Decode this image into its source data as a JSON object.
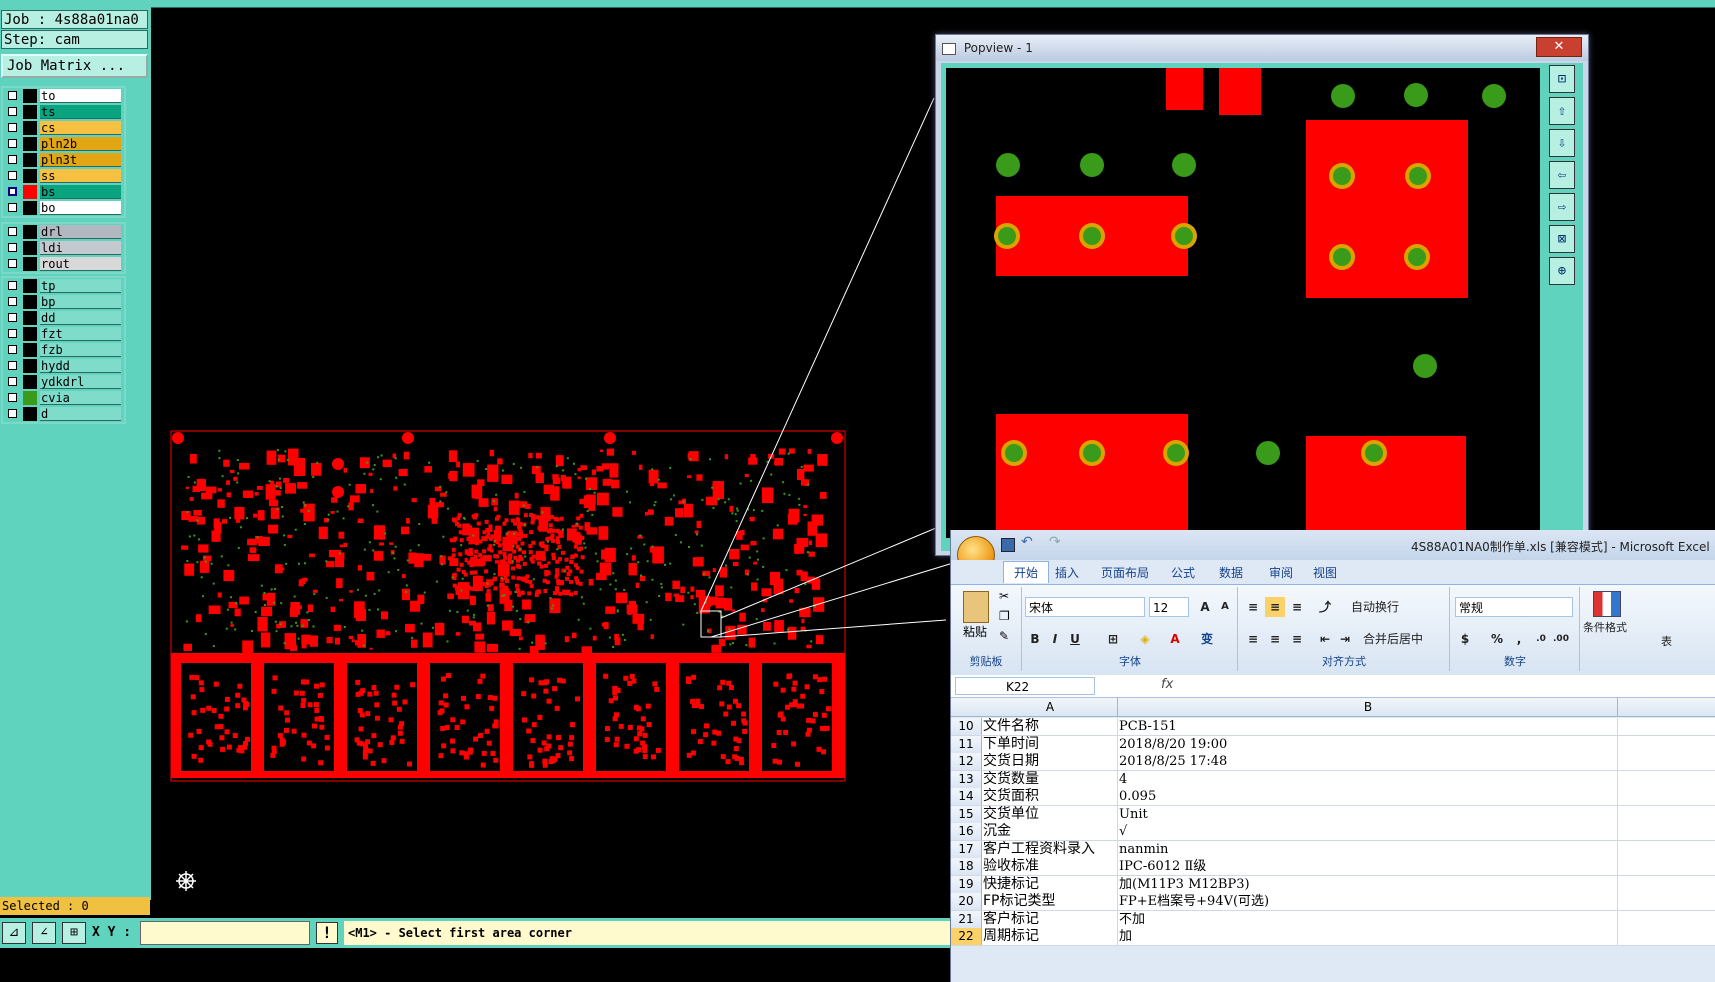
{
  "job": {
    "job_line": "Job : 4s88a01na0",
    "step_line": "Step: cam",
    "matrix_btn": "Job Matrix ..."
  },
  "layers_board": [
    {
      "name": "to",
      "color": "#ffffff",
      "checked": false,
      "marker": "#000000"
    },
    {
      "name": "ts",
      "color": "#0aa37f",
      "checked": false,
      "marker": "#000000"
    },
    {
      "name": "cs",
      "color": "#f6c142",
      "checked": false,
      "marker": "#000000"
    },
    {
      "name": "pln2b",
      "color": "#e2a614",
      "checked": false,
      "marker": "#000000"
    },
    {
      "name": "pln3t",
      "color": "#e2a614",
      "checked": false,
      "marker": "#000000"
    },
    {
      "name": "ss",
      "color": "#f6c142",
      "checked": false,
      "marker": "#000000"
    },
    {
      "name": "bs",
      "color": "#0aa37f",
      "checked": true,
      "marker": "#ff0000"
    },
    {
      "name": "bo",
      "color": "#ffffff",
      "checked": false,
      "marker": "#000000"
    }
  ],
  "layers_drill": [
    {
      "name": "drl",
      "color": "#b3b8c0",
      "checked": false,
      "marker": "#000000"
    },
    {
      "name": "ldi",
      "color": "#c4c8cf",
      "checked": false,
      "marker": "#000000"
    },
    {
      "name": "rout",
      "color": "#d8d8d8",
      "checked": false,
      "marker": "#000000"
    }
  ],
  "layers_misc": [
    {
      "name": "tp",
      "color": "#7fdccb",
      "checked": false,
      "marker": "#000000"
    },
    {
      "name": "bp",
      "color": "#7fdccb",
      "checked": false,
      "marker": "#000000"
    },
    {
      "name": "dd",
      "color": "#7fdccb",
      "checked": false,
      "marker": "#000000"
    },
    {
      "name": "fzt",
      "color": "#7fdccb",
      "checked": false,
      "marker": "#000000"
    },
    {
      "name": "fzb",
      "color": "#7fdccb",
      "checked": false,
      "marker": "#000000"
    },
    {
      "name": "hydd",
      "color": "#7fdccb",
      "checked": false,
      "marker": "#000000"
    },
    {
      "name": "ydkdrl",
      "color": "#7fdccb",
      "checked": false,
      "marker": "#000000"
    },
    {
      "name": "cvia",
      "color": "#7fdccb",
      "checked": false,
      "marker": "#3a9a1a"
    },
    {
      "name": "d",
      "color": "#7fdccb",
      "checked": false,
      "marker": "#000000"
    }
  ],
  "status": {
    "selected": "Selected : 0",
    "xy_label": "X Y :",
    "xy_value": "",
    "prompt": "<M1> - Select first area corner"
  },
  "popview": {
    "title": "Popview - 1",
    "close": "✕"
  },
  "excel": {
    "title": "4S88A01NA0制作单.xls  [兼容模式] - Microsoft Excel",
    "tabs": [
      "开始",
      "插入",
      "页面布局",
      "公式",
      "数据",
      "审阅",
      "视图"
    ],
    "ribbon": {
      "paste": "粘贴",
      "clipboard": "剪贴板",
      "font_name": "宋体",
      "font_size": "12",
      "font_group": "字体",
      "wrap": "自动换行",
      "merge": "合并后居中",
      "align_group": "对齐方式",
      "number_format": "常规",
      "number_group": "数字",
      "cond_format": "条件格式",
      "table_frag": "表"
    },
    "name_box": "K22",
    "fx": "fx",
    "col_a": "A",
    "col_b": "B",
    "rows": [
      {
        "n": "10",
        "a": "文件名称",
        "b": "PCB-151"
      },
      {
        "n": "11",
        "a": "下单时间",
        "b": "2018/8/20 19:00"
      },
      {
        "n": "12",
        "a": "交货日期",
        "b": "2018/8/25 17:48"
      },
      {
        "n": "13",
        "a": "交货数量",
        "b": "4"
      },
      {
        "n": "14",
        "a": "交货面积",
        "b": "0.095"
      },
      {
        "n": "15",
        "a": "交货单位",
        "b": "Unit"
      },
      {
        "n": "16",
        "a": "沉金",
        "b": "√"
      },
      {
        "n": "17",
        "a": "客户工程资料录入",
        "b": "nanmin"
      },
      {
        "n": "18",
        "a": "验收标准",
        "b": "IPC-6012 Ⅱ级"
      },
      {
        "n": "19",
        "a": "快捷标记",
        "b": "加(M11P3 M12BP3)"
      },
      {
        "n": "20",
        "a": "FP标记类型",
        "b": "FP+E档案号+94V(可选)"
      },
      {
        "n": "21",
        "a": "客户标记",
        "b": "不加"
      },
      {
        "n": "22",
        "a": "周期标记",
        "b": "加"
      }
    ]
  },
  "colors": {
    "panel": "#5fd3bd",
    "pad_red": "#ff0000",
    "pad_green": "#3a9a1a",
    "ring": "#d9a300"
  }
}
